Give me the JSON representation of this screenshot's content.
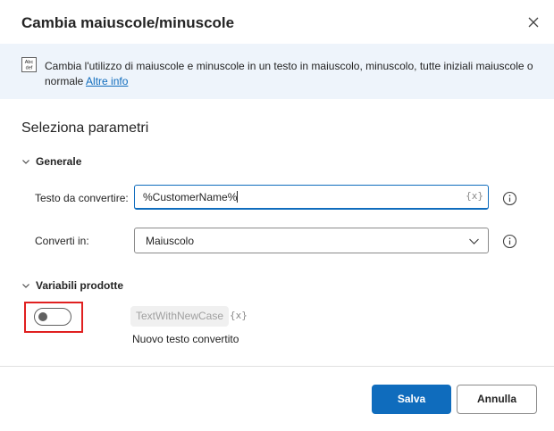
{
  "dialog": {
    "title": "Cambia maiuscole/minuscole",
    "close_icon": "close-icon"
  },
  "info": {
    "icon": "text-case-icon",
    "icon_glyph_top": "Abc",
    "icon_glyph_bottom": "def",
    "text": "Cambia l'utilizzo di maiuscole e minuscole in un testo in maiuscolo, minuscolo, tutte iniziali maiuscole o normale",
    "link_label": "Altre info"
  },
  "params": {
    "section_title": "Seleziona parametri",
    "general": {
      "header": "Generale",
      "text_to_convert": {
        "label": "Testo da convertire:",
        "value": "%CustomerName%",
        "var_token": "{x}"
      },
      "convert_to": {
        "label": "Converti in:",
        "selected": "Maiuscolo"
      }
    },
    "produced_variables": {
      "header": "Variabili prodotte",
      "toggle_on": false,
      "variable_name": "TextWithNewCase",
      "var_token": "{x}",
      "description": "Nuovo testo convertito"
    }
  },
  "footer": {
    "save_label": "Salva",
    "cancel_label": "Annulla"
  },
  "colors": {
    "accent": "#0f6cbd",
    "info_bg": "#eef4fb",
    "highlight": "#e02020"
  }
}
